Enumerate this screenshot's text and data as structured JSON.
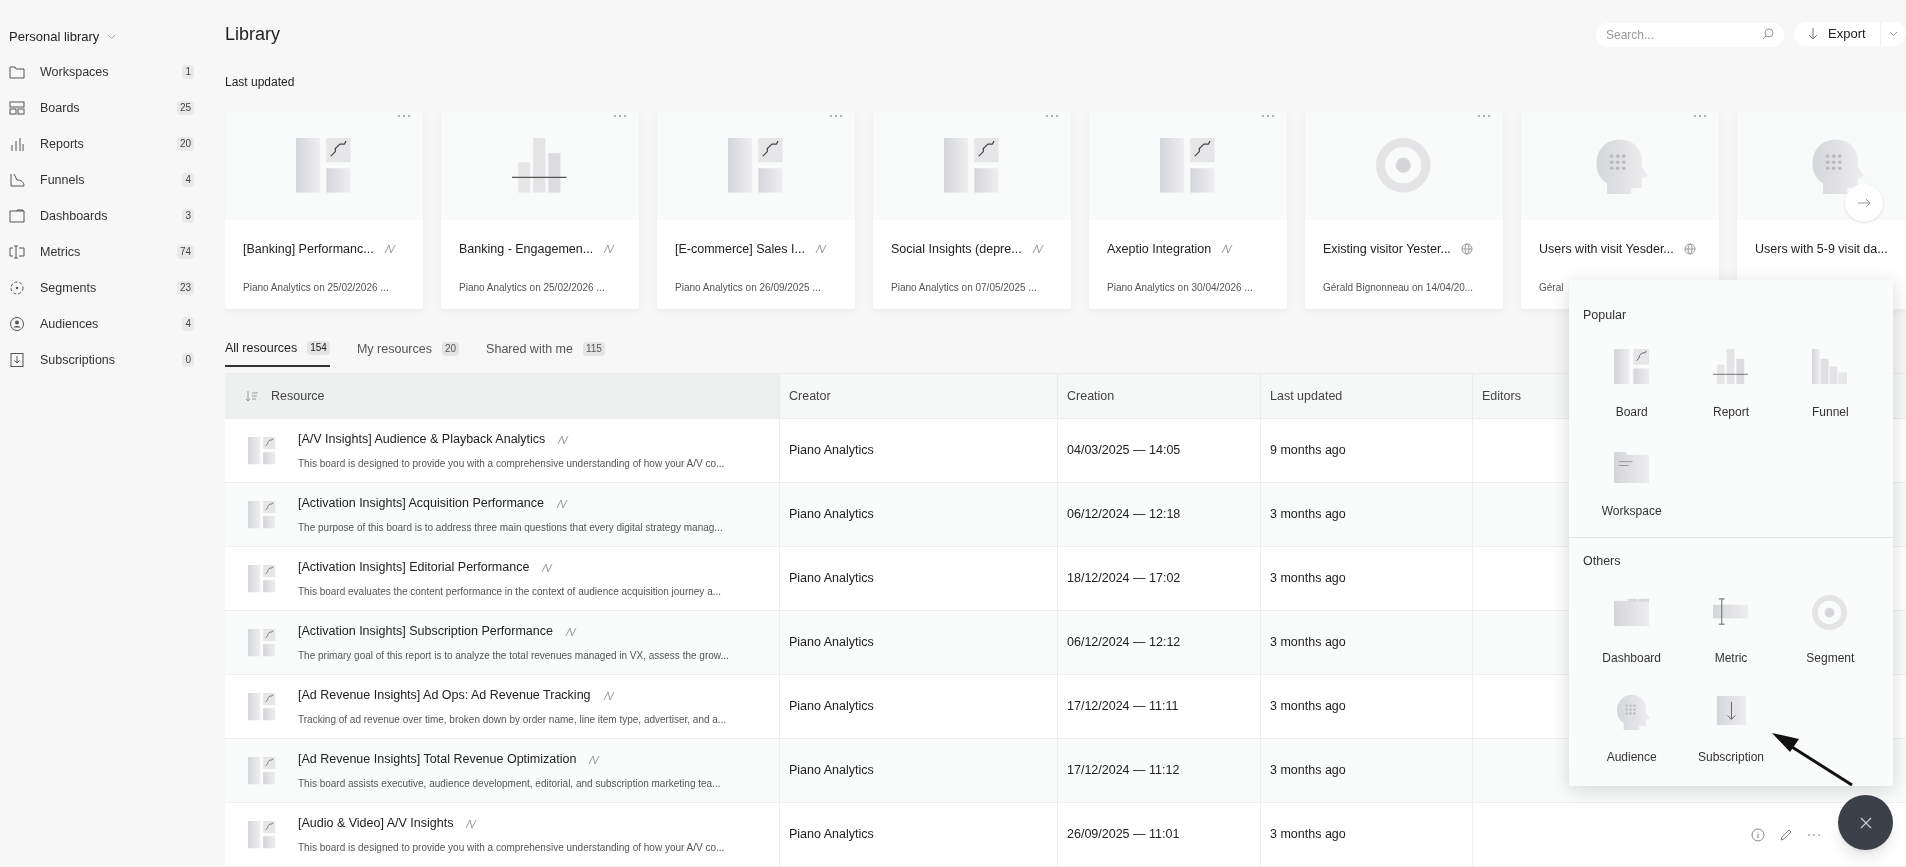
{
  "sidebar": {
    "library": "Personal library",
    "items": [
      {
        "kind": "folder",
        "label": "Workspaces",
        "count": "1"
      },
      {
        "kind": "board",
        "label": "Boards",
        "count": "25"
      },
      {
        "kind": "report",
        "label": "Reports",
        "count": "20"
      },
      {
        "kind": "funnel",
        "label": "Funnels",
        "count": "4"
      },
      {
        "kind": "dashboard",
        "label": "Dashboards",
        "count": "3"
      },
      {
        "kind": "metric",
        "label": "Metrics",
        "count": "74"
      },
      {
        "kind": "segment",
        "label": "Segments",
        "count": "23"
      },
      {
        "kind": "audience",
        "label": "Audiences",
        "count": "4"
      },
      {
        "kind": "subscription",
        "label": "Subscriptions",
        "count": "0"
      }
    ]
  },
  "header": {
    "title": "Library",
    "search_placeholder": "Search...",
    "export": "Export"
  },
  "last_updated": {
    "title": "Last updated",
    "cards": [
      {
        "kind": "board",
        "badge": {
          "kind": "pulse"
        },
        "title": "[Banking] Performanc...",
        "meta": "Piano Analytics on 25/02/2026 ..."
      },
      {
        "kind": "report",
        "badge": {
          "kind": "pulse"
        },
        "title": "Banking - Engagemen...",
        "meta": "Piano Analytics on 25/02/2026 ..."
      },
      {
        "kind": "board",
        "badge": {
          "kind": "pulse"
        },
        "title": "[E-commerce] Sales I...",
        "meta": "Piano Analytics on 26/09/2025 ..."
      },
      {
        "kind": "board",
        "badge": {
          "kind": "pulse"
        },
        "title": "Social Insights (depre...",
        "meta": "Piano Analytics on 07/05/2025 ..."
      },
      {
        "kind": "board",
        "badge": {
          "kind": "pulse"
        },
        "title": "Axeptio Integration",
        "meta": "Piano Analytics on 30/04/2026 ..."
      },
      {
        "kind": "segment",
        "badge": {
          "kind": "globe"
        },
        "title": "Existing visitor Yester...",
        "meta": "Gérald Bignonneau on 14/04/20..."
      },
      {
        "kind": "audience",
        "badge": {
          "kind": "globe"
        },
        "title": "Users with visit Yesder...",
        "meta": "Géral"
      },
      {
        "kind": "audience",
        "title": "Users with 5-9 visit da..."
      }
    ]
  },
  "tabs": [
    {
      "label": "All resources",
      "count": "154",
      "selected": true
    },
    {
      "label": "My resources",
      "count": "20",
      "selected": false
    },
    {
      "label": "Shared with me",
      "count": "115",
      "selected": false
    }
  ],
  "table": {
    "columns": [
      "Resource",
      "Creator",
      "Creation",
      "Last updated",
      "Editors"
    ],
    "rows": [
      {
        "title": "[A/V Insights] Audience & Playback Analytics",
        "description": "This board is designed to provide you with a comprehensive understanding of how your A/V co...",
        "creator": "Piano Analytics",
        "creation": "04/03/2025 — 14:05",
        "updated": "9 months ago"
      },
      {
        "title": "[Activation Insights] Acquisition Performance",
        "description": "The purpose of this board is to address three main questions that every digital strategy manag...",
        "creator": "Piano Analytics",
        "creation": "06/12/2024 — 12:18",
        "updated": "3 months ago"
      },
      {
        "title": "[Activation Insights] Editorial Performance",
        "description": "This board evaluates the content performance in the context of audience acquisition journey a...",
        "creator": "Piano Analytics",
        "creation": "18/12/2024 — 17:02",
        "updated": "3 months ago"
      },
      {
        "title": "[Activation Insights] Subscription Performance",
        "description": "The primary goal of this report is to analyze the total revenues managed in VX, assess the grow...",
        "creator": "Piano Analytics",
        "creation": "06/12/2024 — 12:12",
        "updated": "3 months ago"
      },
      {
        "title": "[Ad Revenue Insights] Ad Ops: Ad Revenue Tracking",
        "description": "Tracking of ad revenue over time, broken down by order name, line item type, advertiser, and a...",
        "creator": "Piano Analytics",
        "creation": "17/12/2024 — 11:11",
        "updated": "3 months ago"
      },
      {
        "title": "[Ad Revenue Insights] Total Revenue Optimization",
        "description": "This board assists executive, audience development, editorial, and subscription marketing tea...",
        "creator": "Piano Analytics",
        "creation": "17/12/2024 — 11:12",
        "updated": "3 months ago"
      },
      {
        "title": "[Audio & Video] A/V Insights",
        "description": "This board is designed to provide you with a comprehensive understanding of how your A/V co...",
        "creator": "Piano Analytics",
        "creation": "26/09/2025 — 11:01",
        "updated": "3 months ago",
        "hovered": true
      }
    ]
  },
  "create_menu": {
    "sections": [
      {
        "title": "Popular",
        "items": [
          {
            "kind": "board",
            "label": "Board"
          },
          {
            "kind": "report",
            "label": "Report"
          },
          {
            "kind": "funnel",
            "label": "Funnel"
          },
          {
            "kind": "workspace",
            "label": "Workspace"
          }
        ]
      },
      {
        "title": "Others",
        "items": [
          {
            "kind": "dashboard",
            "label": "Dashboard"
          },
          {
            "kind": "metric",
            "label": "Metric"
          },
          {
            "kind": "segment",
            "label": "Segment"
          },
          {
            "kind": "audience",
            "label": "Audience"
          },
          {
            "kind": "subscription",
            "label": "Subscription"
          }
        ]
      }
    ]
  }
}
